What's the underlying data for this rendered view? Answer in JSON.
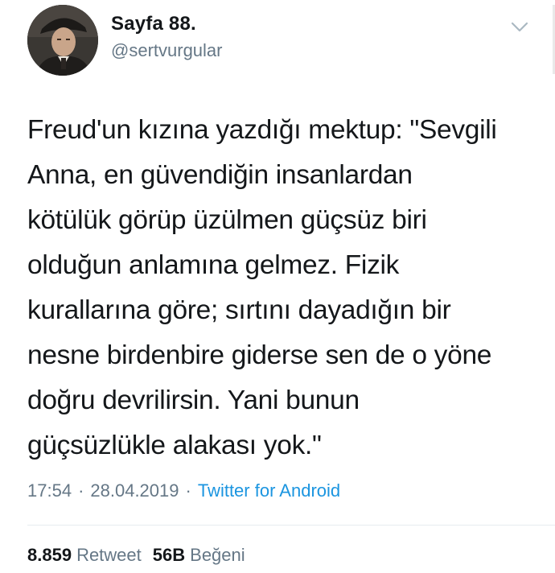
{
  "user": {
    "name": "Sayfa 88.",
    "handle": "@sertvurgular"
  },
  "tweet": {
    "text": "Freud'un kızına yazdığı mektup: \"Sevgili\nAnna, en güvendiğin insanlardan\nkötülük görüp üzülmen güçsüz biri\nolduğun anlamına gelmez. Fizik\nkurallarına göre; sırtını dayadığın bir\nnesne birdenbire giderse sen de o yöne\ndoğru devrilirsin. Yani bunun\ngüçsüzlükle alakası yok.\"",
    "time": "17:54",
    "separator": "·",
    "date": "28.04.2019",
    "source": "Twitter for Android"
  },
  "stats": {
    "retweets_count": "8.859",
    "retweets_label": "Retweet",
    "likes_count": "56B",
    "likes_label": "Beğeni"
  },
  "icons": {
    "caret": "chevron-down-icon",
    "avatar": "avatar"
  },
  "colors": {
    "text": "#14171a",
    "secondary": "#657786",
    "link": "#1b95e0",
    "divider": "#e6ecf0"
  }
}
